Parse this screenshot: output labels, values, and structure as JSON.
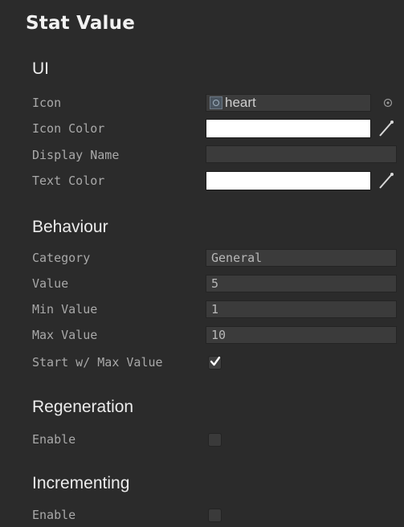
{
  "header": {
    "title": "Stat Value"
  },
  "sections": {
    "ui": {
      "heading": "UI",
      "icon_label": "Icon",
      "icon_value": "heart",
      "icon_color_label": "Icon Color",
      "icon_color_value": "#ffffff",
      "display_name_label": "Display Name",
      "display_name_value": "",
      "text_color_label": "Text Color",
      "text_color_value": "#ffffff"
    },
    "behaviour": {
      "heading": "Behaviour",
      "category_label": "Category",
      "category_value": "General",
      "value_label": "Value",
      "value_value": "5",
      "min_label": "Min Value",
      "min_value": "1",
      "max_label": "Max Value",
      "max_value": "10",
      "start_max_label": "Start w/ Max Value",
      "start_max_checked": true
    },
    "regeneration": {
      "heading": "Regeneration",
      "enable_label": "Enable",
      "enable_checked": false
    },
    "incrementing": {
      "heading": "Incrementing",
      "enable_label": "Enable",
      "enable_checked": false
    }
  },
  "icons": {
    "object_picker": "target-circle-icon",
    "eyedropper": "eyedropper-icon",
    "checkmark": "checkmark-icon"
  },
  "colors": {
    "background": "#2b2b2b",
    "field": "#3b3b3b",
    "label": "#a9a9a9",
    "heading": "#ececec"
  }
}
